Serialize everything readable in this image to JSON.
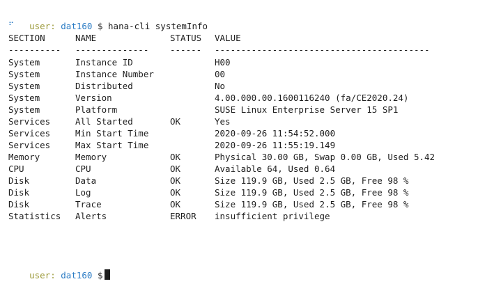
{
  "prompt": {
    "user": "user:",
    "host": "dat160",
    "symbol": "$",
    "command": "hana-cli systemInfo"
  },
  "spinner": "⠋",
  "table": {
    "headers": [
      "SECTION",
      "NAME",
      "STATUS",
      "VALUE"
    ],
    "separators": [
      "----------",
      "--------------",
      "------",
      "-----------------------------------------"
    ],
    "rows": [
      [
        "System",
        "Instance ID",
        "",
        "H00"
      ],
      [
        "System",
        "Instance Number",
        "",
        "00"
      ],
      [
        "System",
        "Distributed",
        "",
        "No"
      ],
      [
        "System",
        "Version",
        "",
        "4.00.000.00.1600116240 (fa/CE2020.24)"
      ],
      [
        "System",
        "Platform",
        "",
        "SUSE Linux Enterprise Server 15 SP1"
      ],
      [
        "Services",
        "All Started",
        "OK",
        "Yes"
      ],
      [
        "Services",
        "Min Start Time",
        "",
        "2020-09-26 11:54:52.000"
      ],
      [
        "Services",
        "Max Start Time",
        "",
        "2020-09-26 11:55:19.149"
      ],
      [
        "Memory",
        "Memory",
        "OK",
        "Physical 30.00 GB, Swap 0.00 GB, Used 5.42"
      ],
      [
        "CPU",
        "CPU",
        "OK",
        "Available 64, Used 0.64"
      ],
      [
        "Disk",
        "Data",
        "OK",
        "Size 119.9 GB, Used 2.5 GB, Free 98 %"
      ],
      [
        "Disk",
        "Log",
        "OK",
        "Size 119.9 GB, Used 2.5 GB, Free 98 %"
      ],
      [
        "Disk",
        "Trace",
        "OK",
        "Size 119.9 GB, Used 2.5 GB, Free 98 %"
      ],
      [
        "Statistics",
        "Alerts",
        "ERROR",
        "insufficient privilege"
      ]
    ]
  },
  "final_prompt": {
    "user": "user:",
    "host": "dat160",
    "symbol": "$"
  },
  "colors": {
    "prompt_user": "#9c9a3a",
    "prompt_host": "#2a7bc4",
    "text": "#1e1e1e",
    "background": "#ffffff"
  }
}
